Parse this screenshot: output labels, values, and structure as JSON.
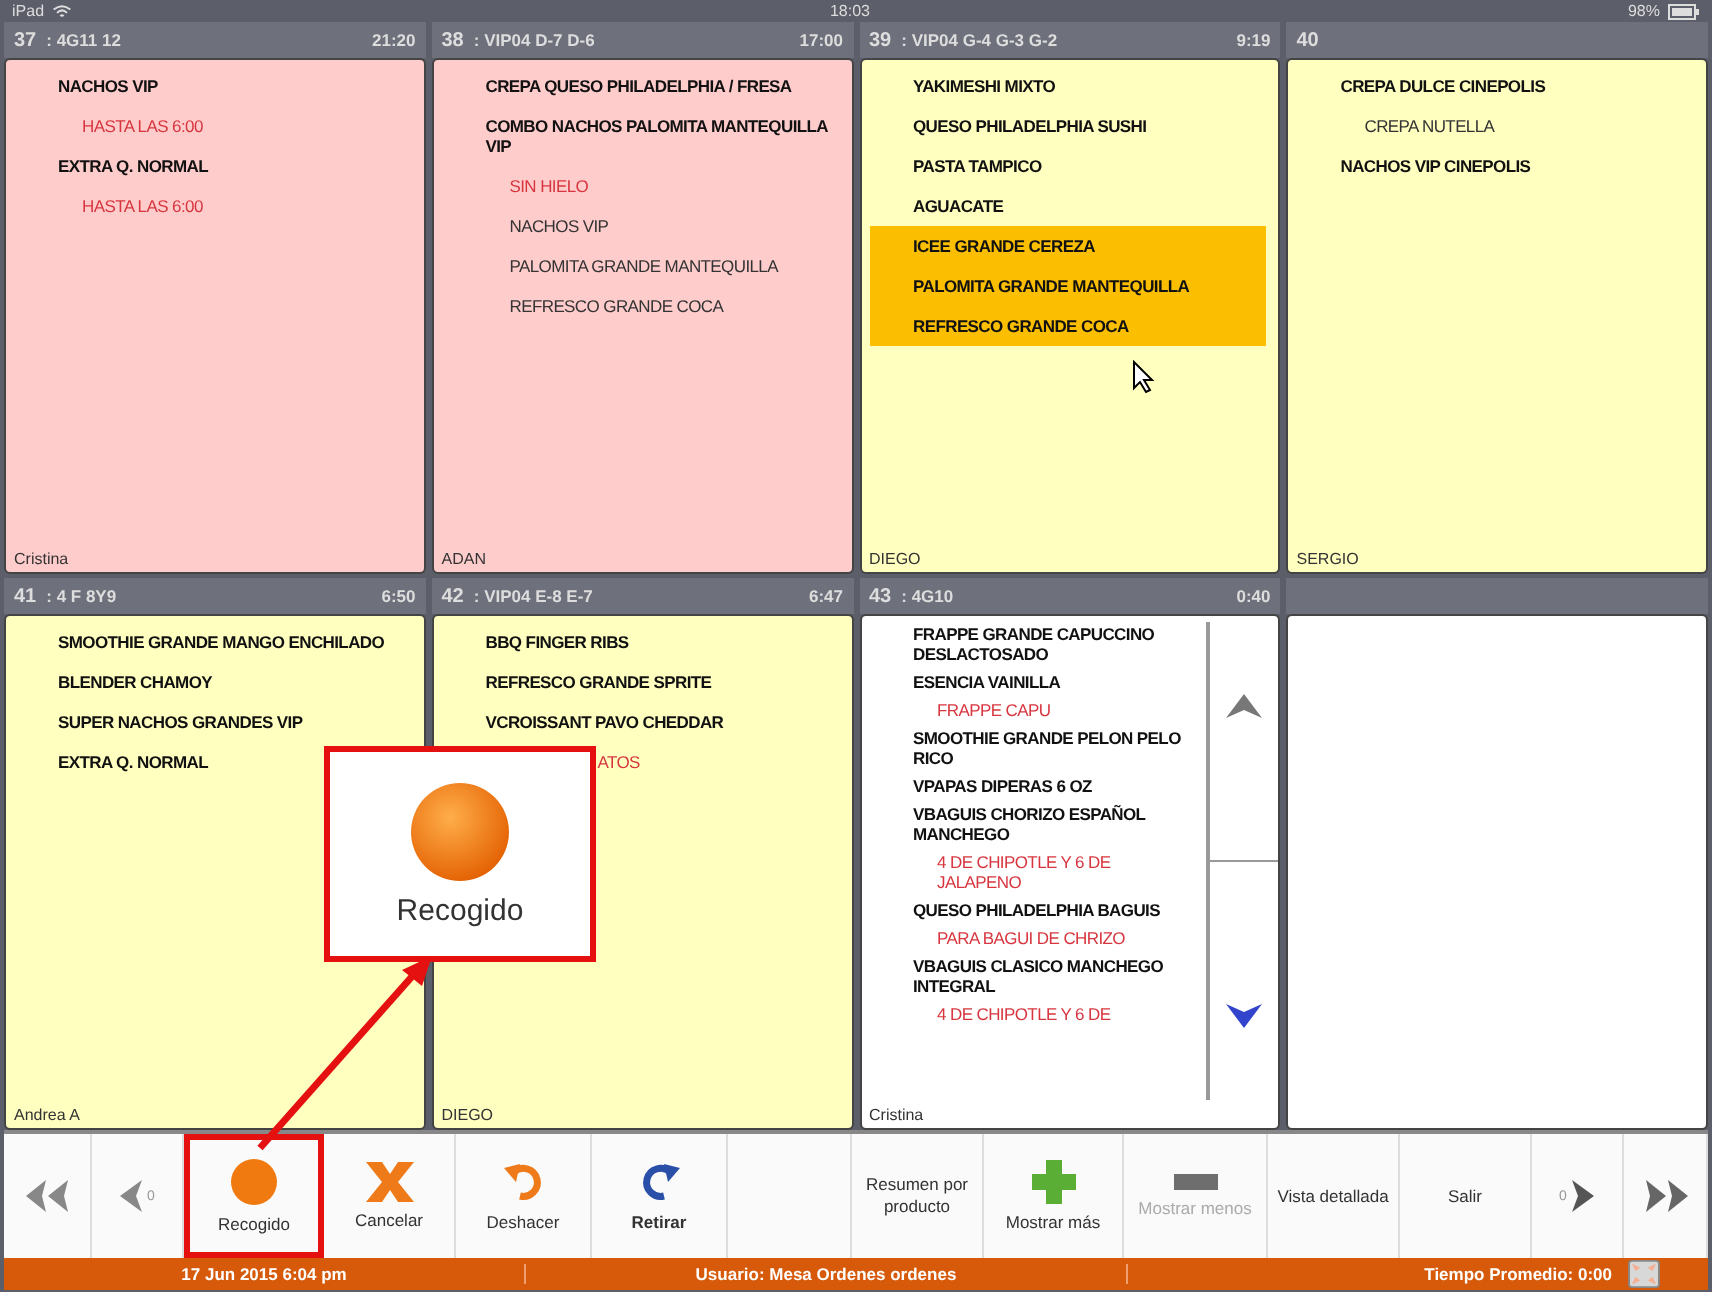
{
  "device_status": {
    "device": "iPad",
    "time": "18:03",
    "battery": "98%"
  },
  "cards": [
    {
      "kind": "order",
      "number": "37",
      "table": ": 4G11 12",
      "time": "21:20",
      "color": "#ffcccc",
      "waiter": "Cristina",
      "items": [
        {
          "kind": "item",
          "text": "NACHOS VIP",
          "selected": false
        },
        {
          "kind": "modifier",
          "text": "HASTA  LAS  6:00",
          "selected": false
        },
        {
          "kind": "item",
          "text": "EXTRA Q. NORMAL",
          "selected": false
        },
        {
          "kind": "modifier",
          "text": "HASTA  LAS  6:00",
          "selected": false
        }
      ]
    },
    {
      "kind": "order",
      "number": "38",
      "table": ": VIP04 D-7 D-6",
      "time": "17:00",
      "color": "#ffcccc",
      "waiter": "ADAN",
      "items": [
        {
          "kind": "item",
          "text": "CREPA QUESO PHILADELPHIA / FRESA",
          "selected": false
        },
        {
          "kind": "item",
          "text": "COMBO NACHOS PALOMITA MANTEQUILLA VIP",
          "selected": false
        },
        {
          "kind": "modifier",
          "text": "SIN HIELO",
          "selected": false
        },
        {
          "kind": "sub",
          "text": "NACHOS VIP",
          "selected": false
        },
        {
          "kind": "sub",
          "text": "PALOMITA GRANDE MANTEQUILLA",
          "selected": false
        },
        {
          "kind": "sub",
          "text": "REFRESCO GRANDE COCA",
          "selected": false
        }
      ]
    },
    {
      "kind": "order",
      "number": "39",
      "table": ": VIP04 G-4 G-3 G-2",
      "time": "9:19",
      "color": "#ffffc0",
      "waiter": "DIEGO",
      "items": [
        {
          "kind": "item",
          "text": "YAKIMESHI MIXTO",
          "selected": false
        },
        {
          "kind": "item",
          "text": "QUESO PHILADELPHIA SUSHI",
          "selected": false
        },
        {
          "kind": "item",
          "text": "PASTA TAMPICO",
          "selected": false
        },
        {
          "kind": "item",
          "text": "AGUACATE",
          "selected": false
        },
        {
          "kind": "item",
          "text": "ICEE GRANDE CEREZA",
          "selected": true
        },
        {
          "kind": "item",
          "text": "PALOMITA GRANDE MANTEQUILLA",
          "selected": true
        },
        {
          "kind": "item",
          "text": "REFRESCO GRANDE COCA",
          "selected": true
        }
      ]
    },
    {
      "kind": "order",
      "number": "40",
      "color": "#ffffc0",
      "waiter": "SERGIO",
      "items": [
        {
          "kind": "item",
          "text": "CREPA DULCE CINEPOLIS",
          "selected": false
        },
        {
          "kind": "sub",
          "text": "CREPA NUTELLA",
          "selected": false
        },
        {
          "kind": "item",
          "text": "NACHOS VIP CINEPOLIS",
          "selected": false
        }
      ]
    },
    {
      "kind": "order",
      "number": "41",
      "table": ": 4 F 8Y9",
      "time": "6:50",
      "color": "#ffffc0",
      "waiter": "Andrea A",
      "items": [
        {
          "kind": "item",
          "text": "SMOOTHIE GRANDE MANGO ENCHILADO",
          "selected": false
        },
        {
          "kind": "item",
          "text": "BLENDER CHAMOY",
          "selected": false
        },
        {
          "kind": "item",
          "text": "SUPER NACHOS GRANDES VIP",
          "selected": false
        },
        {
          "kind": "item",
          "text": "EXTRA Q. NORMAL",
          "selected": false
        }
      ]
    },
    {
      "kind": "order",
      "number": "42",
      "table": ": VIP04 E-8 E-7",
      "time": "6:47",
      "color": "#ffffc0",
      "waiter": "DIEGO",
      "items": [
        {
          "kind": "item",
          "text": "BBQ FINGER RIBS",
          "selected": false
        },
        {
          "kind": "item",
          "text": "REFRESCO GRANDE SPRITE",
          "selected": false
        },
        {
          "kind": "item",
          "text": "VCROISSANT PAVO CHEDDAR",
          "selected": false
        },
        {
          "kind": "partial",
          "text": "ATOS",
          "selected": false
        }
      ]
    },
    {
      "kind": "scrollable",
      "number": "43",
      "table": ": 4G10",
      "time": "0:40",
      "color": "#ffffff",
      "waiter": "Cristina",
      "items": [
        {
          "kind": "item",
          "text": "FRAPPE GRANDE CAPUCCINO DESLACTOSADO",
          "selected": false
        },
        {
          "kind": "item",
          "text": "ESENCIA VAINILLA",
          "selected": false
        },
        {
          "kind": "modifier",
          "text": "FRAPPE CAPU",
          "selected": false
        },
        {
          "kind": "item",
          "text": "SMOOTHIE GRANDE PELON PELO RICO",
          "selected": false
        },
        {
          "kind": "item",
          "text": "VPAPAS DIPERAS 6 OZ",
          "selected": false
        },
        {
          "kind": "item",
          "text": "VBAGUIS CHORIZO ESPAÑOL MANCHEGO",
          "selected": false
        },
        {
          "kind": "modifier",
          "text": "4  DE CHIPOTLE  Y  6  DE JALAPENO",
          "selected": false
        },
        {
          "kind": "item",
          "text": "QUESO PHILADELPHIA BAGUIS",
          "selected": false
        },
        {
          "kind": "modifier",
          "text": "PARA  BAGUI DE CHRIZO",
          "selected": false
        },
        {
          "kind": "item",
          "text": "VBAGUIS CLASICO MANCHEGO INTEGRAL",
          "selected": false
        },
        {
          "kind": "modifier",
          "text": "4  DE CHIPOTLE  Y  6  DE",
          "selected": false
        }
      ]
    },
    {
      "kind": "empty",
      "color": "#ffffff"
    }
  ],
  "callout": {
    "label": "Recogido"
  },
  "toolbar": {
    "left": [
      {
        "kind": "first",
        "highlighted": false,
        "disabled": false
      },
      {
        "kind": "prev",
        "count": "0",
        "highlighted": false,
        "disabled": false
      },
      {
        "kind": "collect",
        "label": "Recogido",
        "highlighted": true,
        "disabled": false
      },
      {
        "kind": "cancel",
        "label": "Cancelar",
        "highlighted": false,
        "disabled": false
      },
      {
        "kind": "undo",
        "label": "Deshacer",
        "highlighted": false,
        "disabled": false
      },
      {
        "kind": "withdraw",
        "label": "Retirar",
        "highlighted": false,
        "disabled": false
      }
    ],
    "right": [
      {
        "kind": "text",
        "label": "Resumen por producto",
        "highlighted": false,
        "disabled": false
      },
      {
        "kind": "more",
        "label": "Mostrar más",
        "highlighted": false,
        "disabled": false
      },
      {
        "kind": "less",
        "label": "Mostrar menos",
        "highlighted": false,
        "disabled": true
      },
      {
        "kind": "text",
        "label": "Vista detallada",
        "highlighted": false,
        "disabled": false
      },
      {
        "kind": "text",
        "label": "Salir",
        "highlighted": false,
        "disabled": false
      },
      {
        "kind": "next",
        "count": "0",
        "highlighted": false,
        "disabled": false
      },
      {
        "kind": "last",
        "highlighted": false,
        "disabled": false
      }
    ]
  },
  "status_bar": {
    "date": "17 Jun 2015 6:04 pm",
    "user": "Usuario: Mesa Ordenes ordenes",
    "average": "Tiempo Promedio: 0:00"
  }
}
